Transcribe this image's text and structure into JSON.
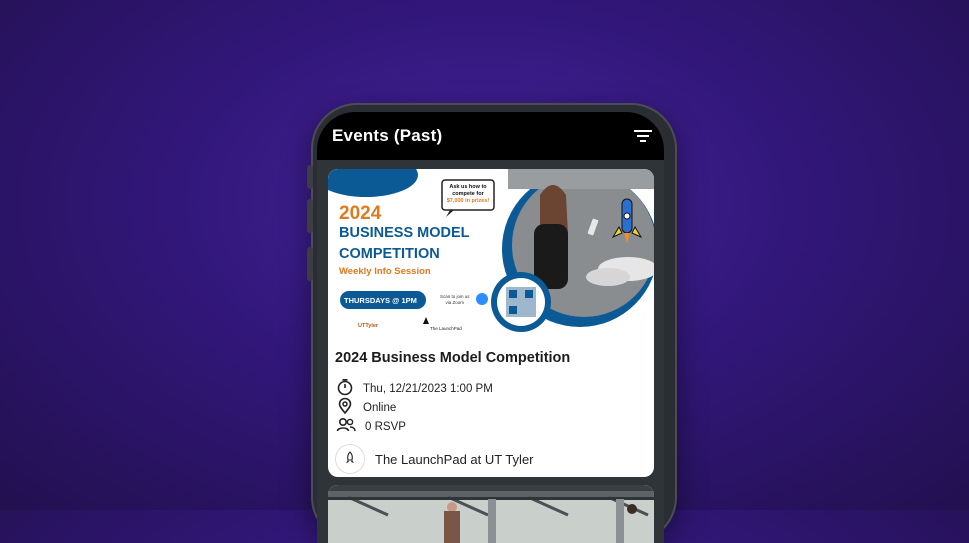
{
  "app": {
    "title": "Events (Past)"
  },
  "icons": {
    "filter": "filter-icon",
    "timer": "timer-icon",
    "location": "location-pin-icon",
    "people": "people-icon",
    "rocket": "rocket-icon",
    "zoom": "zoom-icon"
  },
  "colors": {
    "background": "#32177a",
    "appbar": "#000000",
    "brand_orange": "#e07a1f",
    "brand_blue": "#0b5a96"
  },
  "events": [
    {
      "title": "2024 Business Model Competition",
      "datetime": "Thu, 12/21/2023 1:00 PM",
      "location": "Online",
      "rsvp": "0 RSVP",
      "organizer": "The LaunchPad at UT Tyler",
      "banner": {
        "year": "2024",
        "line1": "BUSINESS MODEL",
        "line2": "COMPETITION",
        "subtitle": "Weekly Info Session",
        "pill": "THURSDAYS @ 1PM",
        "bubble1": "Ask us how to",
        "bubble2": "compete for",
        "bubble3": "$7,000 in prizes!",
        "zoom1": "Scan to join us",
        "zoom2": "via Zoom",
        "logo_left": "UTTyler",
        "logo_right": "The LaunchPad"
      }
    }
  ]
}
